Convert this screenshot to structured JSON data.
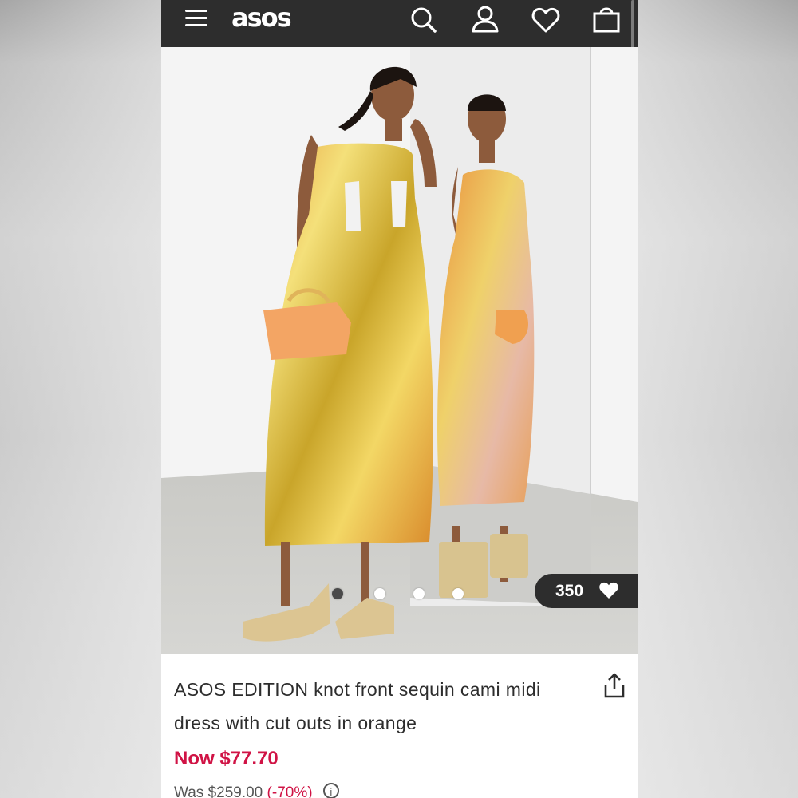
{
  "header": {
    "logo": "asos",
    "icons": [
      "menu-icon",
      "search-icon",
      "account-icon",
      "heart-icon",
      "bag-icon"
    ]
  },
  "gallery": {
    "image_description_name": "product-image",
    "dots_total": 4,
    "active_dot": 1,
    "saves_count": "350"
  },
  "product": {
    "title": "ASOS EDITION knot front sequin cami midi dress with cut outs in orange",
    "now_label": "Now $77.70",
    "was_label": "Was $259.00",
    "discount": "(-70%)"
  },
  "colors": {
    "header_bg": "#2d2d2d",
    "sale_red": "#d01345"
  }
}
